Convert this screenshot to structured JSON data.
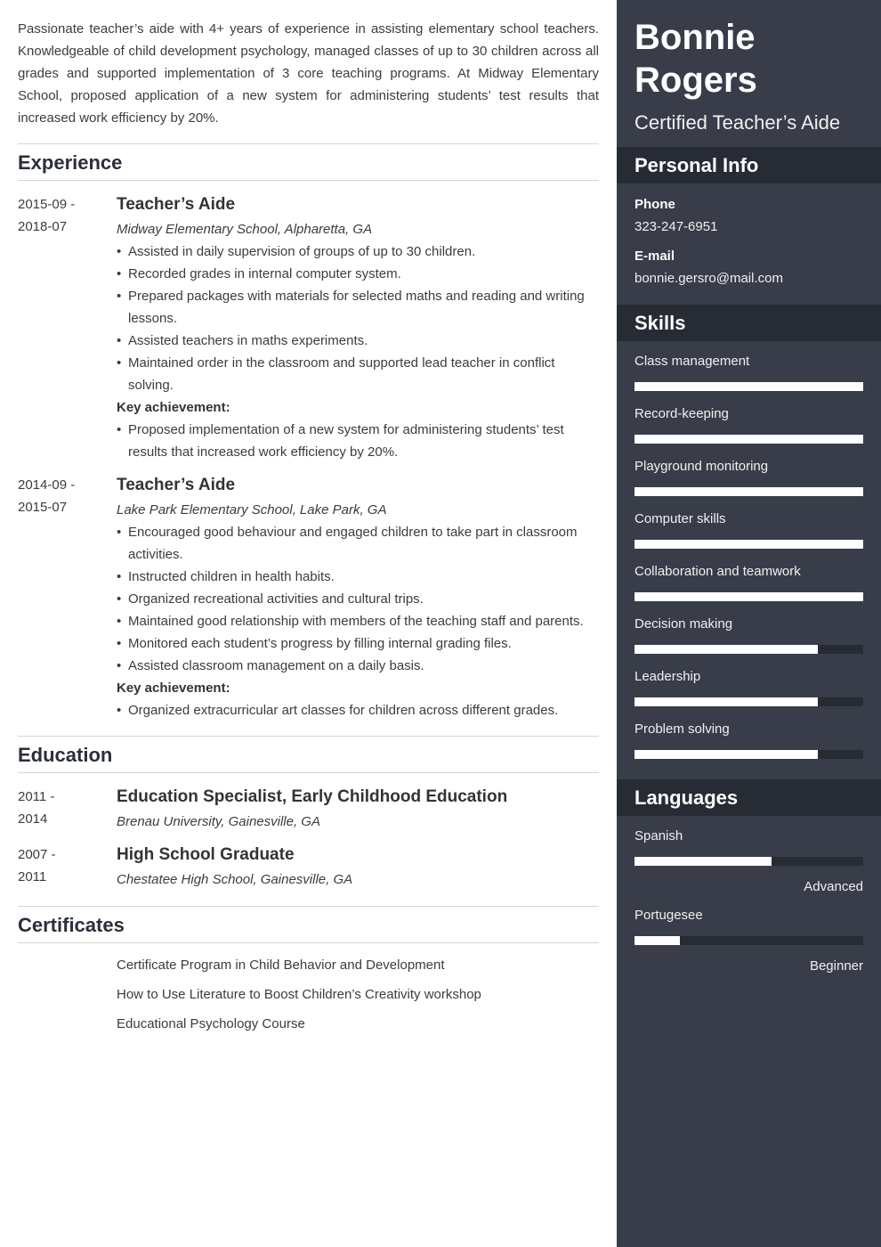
{
  "summary": "Passionate teacher’s aide with 4+ years of experience in assisting elementary school teachers. Knowledgeable of child development psychology, managed classes of up to 30 children across all grades and supported implementation of 3 core teaching programs. At Midway Elementary School, proposed application of a new system for administering students’ test results that increased work efficiency by 20%.",
  "experience": {
    "heading": "Experience",
    "key_label": "Key achievement:",
    "bullet": "•",
    "entries": [
      {
        "date_start": "2015-09 -",
        "date_end": "2018-07",
        "title": "Teacher’s Aide",
        "place": "Midway Elementary School, Alpharetta, GA",
        "bullets": [
          "Assisted in daily supervision of groups of up to 30 children.",
          "Recorded grades in internal computer system.",
          "Prepared packages with materials for selected maths and reading and writing lessons.",
          "Assisted teachers in maths experiments.",
          "Maintained order in the classroom and supported lead teacher in conflict solving."
        ],
        "achievements": [
          "Proposed implementation of a new system for administering students’ test results that increased work efficiency by 20%."
        ]
      },
      {
        "date_start": "2014-09 -",
        "date_end": "2015-07",
        "title": "Teacher’s Aide",
        "place": "Lake Park Elementary School, Lake Park, GA",
        "bullets": [
          "Encouraged good behaviour and engaged children to take part in classroom activities.",
          "Instructed children in health habits.",
          "Organized recreational activities and cultural trips.",
          "Maintained good relationship with members of the teaching staff and parents.",
          "Monitored each student’s progress by filling internal grading files.",
          "Assisted classroom management on a daily basis."
        ],
        "achievements": [
          "Organized extracurricular art classes for children across different grades."
        ]
      }
    ]
  },
  "education": {
    "heading": "Education",
    "entries": [
      {
        "date_start": "2011 -",
        "date_end": "2014",
        "title": "Education Specialist, Early Childhood Education",
        "place": "Brenau University, Gainesville, GA"
      },
      {
        "date_start": "2007 -",
        "date_end": "2011",
        "title": "High School Graduate",
        "place": "Chestatee High School, Gainesville, GA"
      }
    ]
  },
  "certificates": {
    "heading": "Certificates",
    "items": [
      "Certificate Program in Child Behavior and Development",
      "How to Use Literature to Boost Children’s Creativity workshop",
      "Educational Psychology Course"
    ]
  },
  "sidebar": {
    "first_name": "Bonnie",
    "last_name": "Rogers",
    "role": "Certified Teacher’s Aide",
    "personal_info": {
      "heading": "Personal Info",
      "phone_label": "Phone",
      "phone": "323-247-6951",
      "email_label": "E-mail",
      "email": "bonnie.gersro@mail.com"
    },
    "skills": {
      "heading": "Skills",
      "items": [
        {
          "name": "Class management",
          "level": 1.0
        },
        {
          "name": "Record-keeping",
          "level": 1.0
        },
        {
          "name": "Playground monitoring",
          "level": 1.0
        },
        {
          "name": "Computer skills",
          "level": 1.0
        },
        {
          "name": "Collaboration and teamwork",
          "level": 1.0
        },
        {
          "name": "Decision making",
          "level": 0.8
        },
        {
          "name": "Leadership",
          "level": 0.8
        },
        {
          "name": "Problem solving",
          "level": 0.8
        }
      ]
    },
    "languages": {
      "heading": "Languages",
      "items": [
        {
          "name": "Spanish",
          "level": 0.6,
          "level_label": "Advanced"
        },
        {
          "name": "Portugesee",
          "level": 0.2,
          "level_label": "Beginner"
        }
      ]
    }
  },
  "colors": {
    "sidebar_bg": "#383d49",
    "sidebar_header_bg": "#272b34",
    "bar_fill": "#ffffff",
    "heading_text": "#2a2f3a"
  }
}
